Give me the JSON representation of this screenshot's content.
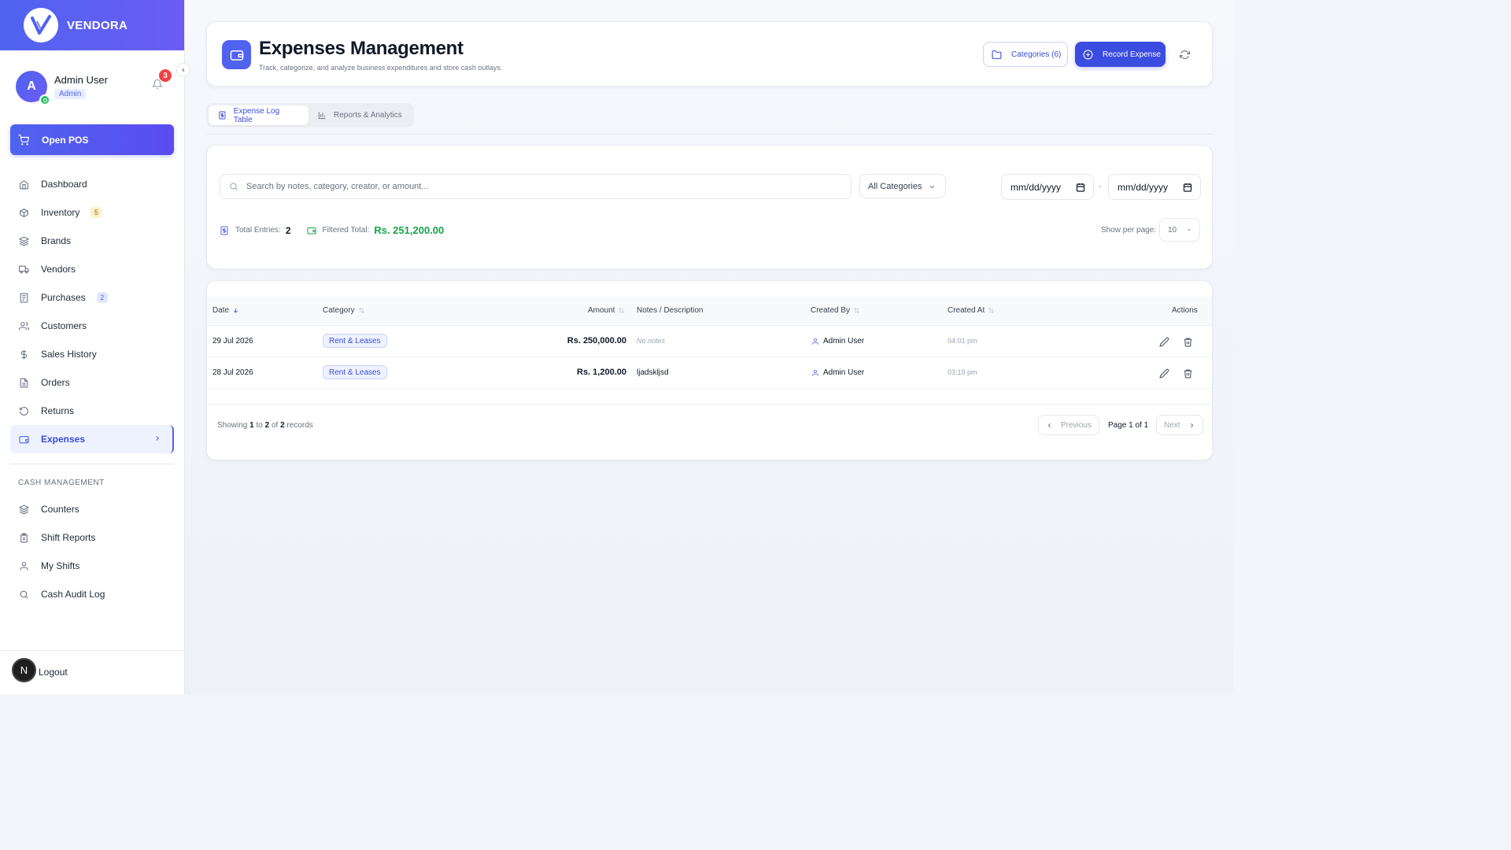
{
  "brand": {
    "name": "VENDORA"
  },
  "user": {
    "initial": "A",
    "name": "Admin User",
    "role": "Admin",
    "notifications": "3"
  },
  "open_pos": {
    "label": "Open POS"
  },
  "nav": [
    {
      "label": "Dashboard",
      "icon": "home-icon"
    },
    {
      "label": "Inventory",
      "icon": "box-icon",
      "badge": "5"
    },
    {
      "label": "Brands",
      "icon": "layers-icon"
    },
    {
      "label": "Vendors",
      "icon": "truck-icon"
    },
    {
      "label": "Purchases",
      "icon": "receipt-icon",
      "badge": "2"
    },
    {
      "label": "Customers",
      "icon": "users-icon"
    },
    {
      "label": "Sales History",
      "icon": "dollar-icon"
    },
    {
      "label": "Orders",
      "icon": "file-icon"
    },
    {
      "label": "Returns",
      "icon": "rotate-icon"
    },
    {
      "label": "Expenses",
      "icon": "wallet-icon",
      "active": true
    }
  ],
  "cash_section": {
    "label": "CASH MANAGEMENT",
    "items": [
      {
        "label": "Counters",
        "icon": "layers-icon"
      },
      {
        "label": "Shift Reports",
        "icon": "clipboard-icon"
      },
      {
        "label": "My Shifts",
        "icon": "user-icon"
      },
      {
        "label": "Cash Audit Log",
        "icon": "search-icon"
      }
    ]
  },
  "logout": {
    "badge": "N",
    "label": "Logout"
  },
  "header": {
    "title": "Expenses Management",
    "subtitle": "Track, categorize, and analyze business expenditures and store cash outlays.",
    "categories_button": "Categories (6)",
    "record_button": "Record Expense"
  },
  "tabs": [
    {
      "label": "Expense Log Table",
      "active": true
    },
    {
      "label": "Reports & Analytics",
      "active": false
    }
  ],
  "filters": {
    "search_placeholder": "Search by notes, category, creator, or amount...",
    "category_selected": "All Categories",
    "date_from_placeholder": "mm/dd/yyyy",
    "date_to_placeholder": "mm/dd/yyyy",
    "date_separator": "-",
    "total_entries_label": "Total Entries:",
    "total_entries": "2",
    "filtered_total_label": "Filtered Total:",
    "filtered_total": "Rs. 251,200.00",
    "per_page_label": "Show per page:",
    "per_page": "10"
  },
  "table": {
    "columns": {
      "date": "Date",
      "category": "Category",
      "amount": "Amount",
      "notes": "Notes / Description",
      "created_by": "Created By",
      "created_at": "Created At",
      "actions": "Actions"
    },
    "rows": [
      {
        "date": "29 Jul 2026",
        "category": "Rent & Leases",
        "amount": "Rs. 250,000.00",
        "notes": "No notes",
        "created_by": "Admin User",
        "created_at": "04:01 pm"
      },
      {
        "date": "28 Jul 2026",
        "category": "Rent & Leases",
        "amount": "Rs. 1,200.00",
        "notes": "ljadskljsd",
        "created_by": "Admin User",
        "created_at": "03:19 pm"
      }
    ]
  },
  "pagination": {
    "showing_prefix": "Showing",
    "from": "1",
    "to_word": "to",
    "to": "2",
    "of_word": "of",
    "total": "2",
    "suffix": "records",
    "previous": "Previous",
    "page_label": "Page 1 of 1",
    "next": "Next"
  },
  "colors": {
    "accent": "#4f63f0",
    "success": "#16a34a",
    "danger": "#ef4444"
  }
}
